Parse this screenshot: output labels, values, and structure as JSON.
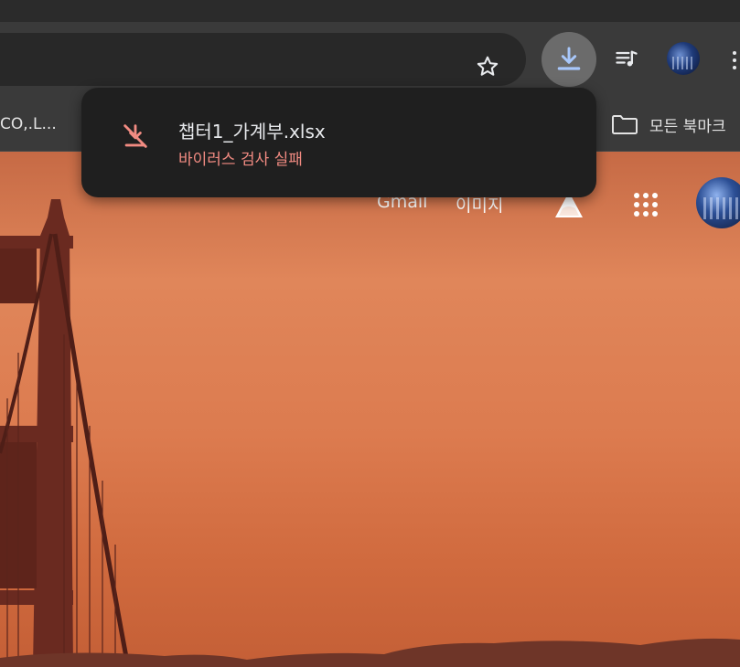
{
  "toolbar": {
    "bookmark_star": "star-icon",
    "downloads_icon": "download-icon",
    "media_icon": "media-queue-icon"
  },
  "bookmarks": {
    "left_item": "CO,.L...",
    "folder_label": "모든 북마크"
  },
  "page": {
    "gmail": "Gmail",
    "images": "이미지"
  },
  "download": {
    "file_name": "챕터1_가계부.xlsx",
    "status": "바이러스 검사 실패"
  },
  "colors": {
    "bubble_bg": "#1f1f1f",
    "status_red": "#f28b82",
    "download_btn_bg": "#6b6b6b",
    "download_icon_blue": "#a8c7fa"
  }
}
